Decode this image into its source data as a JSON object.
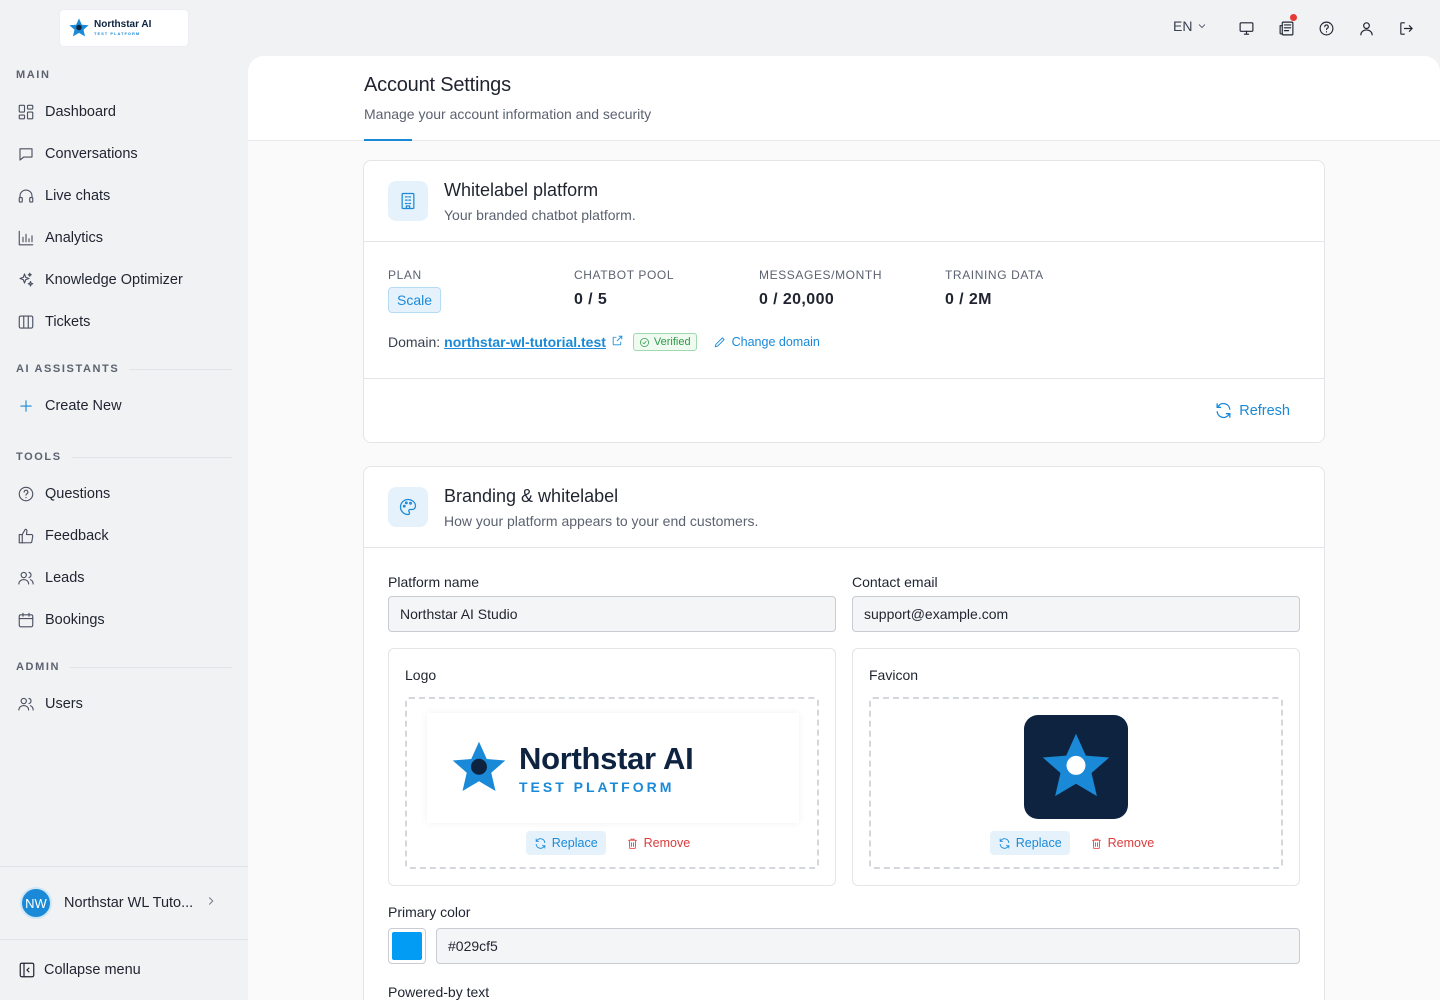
{
  "brand": {
    "name": "Northstar AI",
    "tagline": "TEST PLATFORM"
  },
  "sidebar": {
    "sections": {
      "main": "MAIN",
      "ai_assistants": "AI ASSISTANTS",
      "tools": "TOOLS",
      "admin": "ADMIN"
    },
    "main_items": [
      {
        "label": "Dashboard",
        "icon": "dashboard-icon"
      },
      {
        "label": "Conversations",
        "icon": "chat-bubble-icon"
      },
      {
        "label": "Live chats",
        "icon": "headset-icon"
      },
      {
        "label": "Analytics",
        "icon": "bar-chart-icon"
      },
      {
        "label": "Knowledge Optimizer",
        "icon": "sparkles-icon"
      },
      {
        "label": "Tickets",
        "icon": "columns-icon"
      }
    ],
    "create_new": "Create New",
    "tools_items": [
      {
        "label": "Questions",
        "icon": "question-circle-icon"
      },
      {
        "label": "Feedback",
        "icon": "thumbs-up-icon"
      },
      {
        "label": "Leads",
        "icon": "users-icon"
      },
      {
        "label": "Bookings",
        "icon": "calendar-icon"
      }
    ],
    "admin_items": [
      {
        "label": "Users",
        "icon": "users-icon"
      }
    ],
    "account": {
      "initials": "NW",
      "name": "Northstar WL Tuto..."
    },
    "collapse_label": "Collapse menu"
  },
  "topbar": {
    "language": "EN"
  },
  "page": {
    "title": "Account Settings",
    "subtitle": "Manage your account information and security"
  },
  "whitelabel_card": {
    "title": "Whitelabel platform",
    "subtitle": "Your branded chatbot platform.",
    "stats": {
      "plan_label": "PLAN",
      "plan_value": "Scale",
      "pool_label": "CHATBOT POOL",
      "pool_value": "0 / 5",
      "messages_label": "MESSAGES/MONTH",
      "messages_value": "0 / 20,000",
      "training_label": "TRAINING DATA",
      "training_value": "0 / 2M"
    },
    "domain_label": "Domain:",
    "domain": "northstar-wl-tutorial.test",
    "verified_label": "Verified",
    "change_domain_label": "Change domain",
    "refresh_label": "Refresh"
  },
  "branding_card": {
    "title": "Branding & whitelabel",
    "subtitle": "How your platform appears to your end customers.",
    "platform_name_label": "Platform name",
    "platform_name_value": "Northstar AI Studio",
    "contact_email_label": "Contact email",
    "contact_email_value": "support@example.com",
    "logo_label": "Logo",
    "favicon_label": "Favicon",
    "replace_label": "Replace",
    "remove_label": "Remove",
    "primary_color_label": "Primary color",
    "primary_color_value": "#029cf5",
    "powered_by_label": "Powered-by text"
  },
  "colors": {
    "accent": "#1a8ad8",
    "primary": "#029cf5",
    "navy": "#0d2340",
    "danger": "#d93d3d",
    "success": "#2e9a48"
  }
}
